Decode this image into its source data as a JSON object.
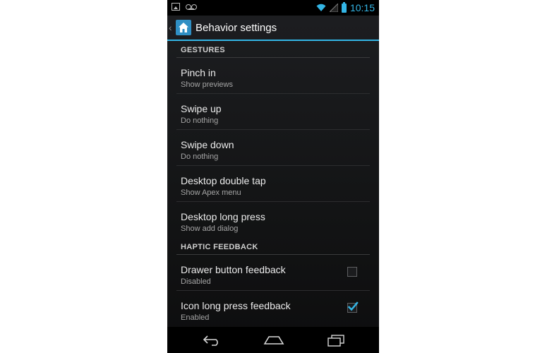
{
  "status_bar": {
    "time": "10:15",
    "icons_left": [
      "image-icon",
      "voicemail-icon"
    ],
    "icons_right": [
      "wifi-icon",
      "signal-icon",
      "battery-icon"
    ],
    "accent": "#33b5e5"
  },
  "action_bar": {
    "title": "Behavior settings",
    "up_indicator": "‹",
    "app_icon": "home-icon"
  },
  "sections": [
    {
      "header": "GESTURES",
      "items": [
        {
          "title": "Pinch in",
          "summary": "Show previews"
        },
        {
          "title": "Swipe up",
          "summary": "Do nothing"
        },
        {
          "title": "Swipe down",
          "summary": "Do nothing"
        },
        {
          "title": "Desktop double tap",
          "summary": "Show Apex menu"
        },
        {
          "title": "Desktop long press",
          "summary": "Show add dialog"
        }
      ]
    },
    {
      "header": "HAPTIC FEEDBACK",
      "items": [
        {
          "title": "Drawer button feedback",
          "summary": "Disabled",
          "checked": false
        },
        {
          "title": "Icon long press feedback",
          "summary": "Enabled",
          "checked": true
        }
      ]
    }
  ],
  "nav_bar": {
    "buttons": [
      "back-icon",
      "home-icon",
      "recents-icon"
    ]
  }
}
